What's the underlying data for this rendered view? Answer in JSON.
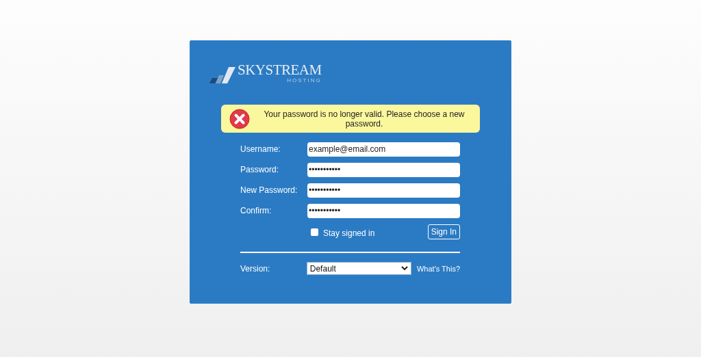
{
  "logo": {
    "name": "SKYSTREAM",
    "tagline": "HOSTING"
  },
  "alert": {
    "message": "Your password is no longer valid. Please choose a new password."
  },
  "fields": [
    {
      "label": "Username:",
      "value": "example@email.com"
    },
    {
      "label": "Password:",
      "value": "•••••••••••"
    },
    {
      "label": "New Password:",
      "value": "•••••••••••"
    },
    {
      "label": "Confirm:",
      "value": "•••••••••••"
    }
  ],
  "stay_signed_in": {
    "label": "Stay signed in",
    "checked": false
  },
  "sign_in_button": "Sign In",
  "version": {
    "label": "Version:",
    "value": "Default",
    "help_link": "What's This?"
  }
}
